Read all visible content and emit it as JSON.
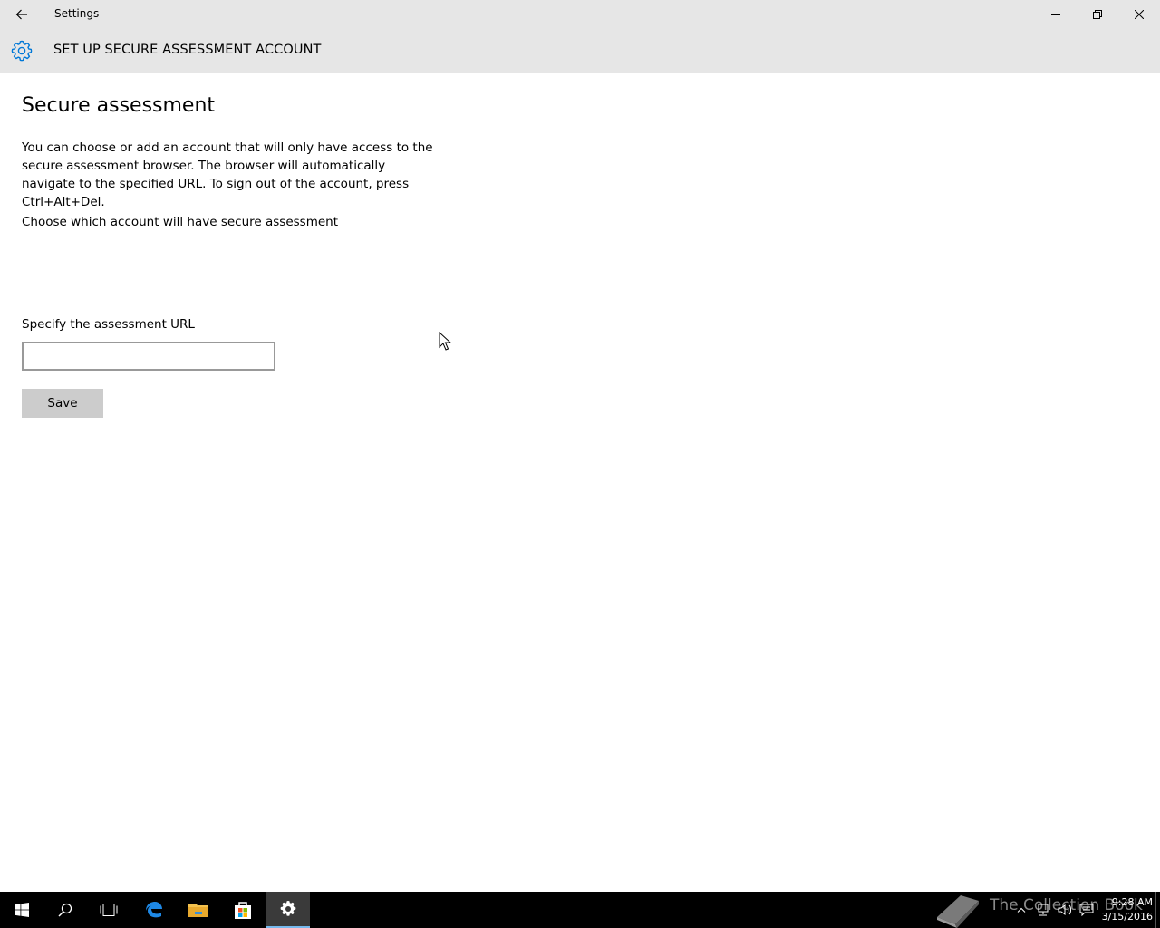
{
  "window": {
    "title": "Settings"
  },
  "header": {
    "title": "SET UP SECURE ASSESSMENT ACCOUNT"
  },
  "content": {
    "section_title": "Secure assessment",
    "description": "You can choose or add an account that will only have access to the secure assessment browser. The browser will automatically navigate to the specified URL. To sign out of the account, press Ctrl+Alt+Del.",
    "choose_account_label": "Choose which account will have secure assessment",
    "url_label": "Specify the assessment URL",
    "url_value": "",
    "url_placeholder": "",
    "save_label": "Save"
  },
  "taskbar": {
    "items": [
      "start-icon",
      "search-icon",
      "task-view-icon",
      "edge-icon",
      "file-explorer-icon",
      "store-icon",
      "settings-icon"
    ],
    "active_item": "settings-icon",
    "clock_time": "9:28 AM",
    "clock_date": "3/15/2016"
  },
  "watermark": {
    "text": "The Collection Book"
  },
  "colors": {
    "chrome_bg": "#e6e6e6",
    "accent": "#0078d7",
    "button_bg": "#cccccc",
    "taskbar_bg": "#000000"
  }
}
